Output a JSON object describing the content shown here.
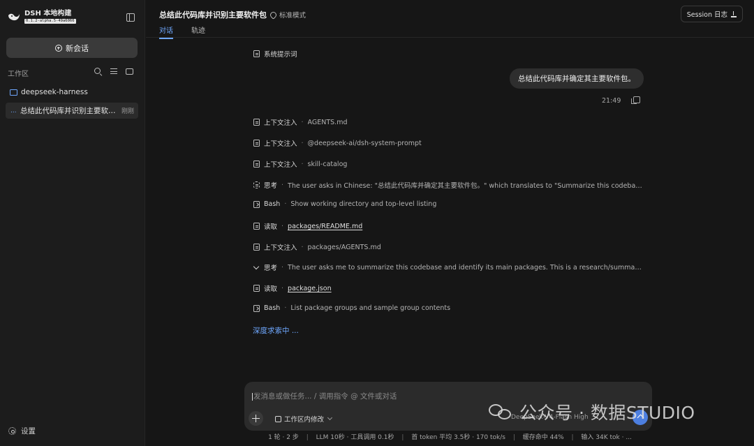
{
  "sidebar": {
    "brand_name": "DSH 本地构建",
    "brand_version": "0.1.2-alpha.5-49a6066",
    "new_chat_label": "新会话",
    "workspace_label": "工作区",
    "folder_name": "deepseek-harness",
    "session": {
      "prefix": "...",
      "title": "总结此代码库并识别主要软件包",
      "time": "刚刚"
    },
    "settings_label": "设置"
  },
  "header": {
    "title": "总结此代码库并识别主要软件包",
    "mode": "标准模式",
    "tabs": [
      "对话",
      "轨迹"
    ],
    "session_log": "Session 日志"
  },
  "conversation": {
    "system_prompt": "系统提示词",
    "user_message": "总结此代码库并确定其主要软件包。",
    "message_time": "21:49",
    "separator": "·",
    "steps": [
      {
        "kind": "file",
        "label": "上下文注入",
        "detail": "AGENTS.md"
      },
      {
        "kind": "file",
        "label": "上下文注入",
        "detail": "@deepseek-ai/dsh-system-prompt"
      },
      {
        "kind": "file",
        "label": "上下文注入",
        "detail": "skill-catalog"
      },
      {
        "kind": "think",
        "label": "思考",
        "detail": "The user asks in Chinese: \"总结此代码库并确定其主要软件包。\" which translates to \"Summarize this codebase a..."
      },
      {
        "kind": "term",
        "label": "Bash",
        "detail": "Show working directory and top-level listing"
      },
      {
        "kind": "read",
        "label": "读取",
        "detail": "packages/README.md"
      },
      {
        "kind": "file",
        "label": "上下文注入",
        "detail": "packages/AGENTS.md"
      },
      {
        "kind": "chev",
        "label": "思考",
        "detail": "The user asks me to summarize this codebase and identify its main packages. This is a research/summary task. ..."
      },
      {
        "kind": "read",
        "label": "读取",
        "detail": "package.json"
      },
      {
        "kind": "term",
        "label": "Bash",
        "detail": "List package groups and sample group contents"
      }
    ],
    "searching": "深度求索中 ..."
  },
  "composer": {
    "placeholder": "发消息或做任务... / 调用指令 @ 文件或对话",
    "workspace_edit": "工作区内修改",
    "model": "DeepSeek-V4-Flash High"
  },
  "watermark": {
    "text": "公众号 · 数据STUDIO"
  },
  "statusbar": {
    "items": [
      "1 轮 · 2 步",
      "LLM 10秒 · 工具调用 0.1秒",
      "首 token 平均 3.5秒 · 170 tok/s",
      "缓存命中 44%",
      "输入 34K tok · ..."
    ],
    "separator": "|"
  },
  "colors": {
    "accent": "#6fa8ff",
    "background": "#161616",
    "sidebar": "#1c1c1c",
    "send": "#4d7fe0"
  }
}
